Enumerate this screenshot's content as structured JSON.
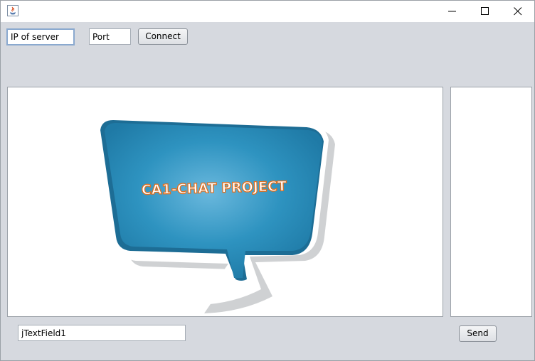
{
  "window": {
    "title": "",
    "controls": {
      "minimize_icon": "minimize-icon",
      "maximize_icon": "maximize-icon",
      "close_icon": "close-icon"
    }
  },
  "connection": {
    "ip_value": "IP of server",
    "port_value": "Port",
    "connect_label": "Connect"
  },
  "chat": {
    "logo_text": "CA1-CHAT PROJECT",
    "logo_colors": {
      "bubble": "#2e93c0",
      "bubble_dark": "#1b6f98",
      "shadow": "#c9cbcd",
      "text_fill": "#ffffff",
      "text_stroke": "#e07020"
    }
  },
  "users": {
    "items": []
  },
  "compose": {
    "message_value": "jTextField1",
    "send_label": "Send"
  }
}
